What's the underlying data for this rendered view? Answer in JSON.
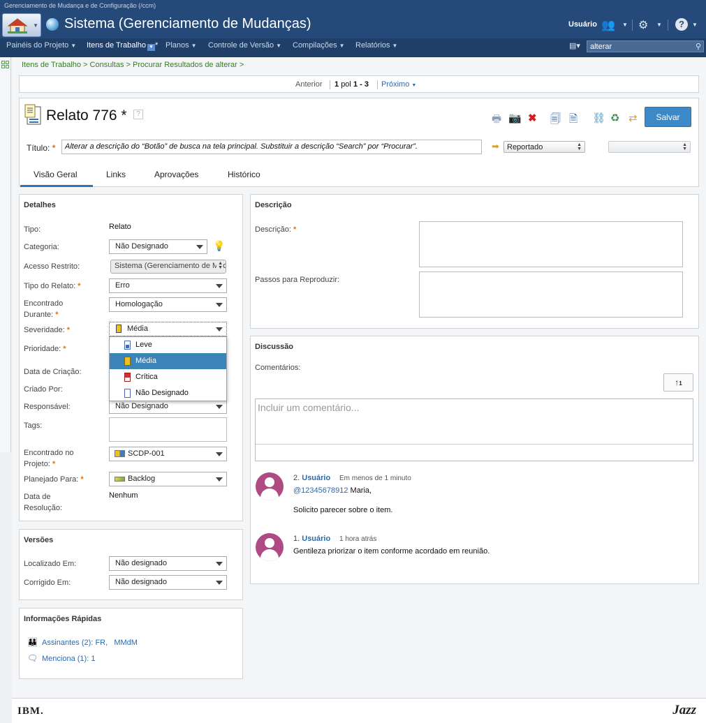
{
  "window": {
    "caption": "Gerenciamento de Mudança e de Configuração (/ccm)"
  },
  "banner": {
    "app_title": "Sistema (Gerenciamento de Mudanças)",
    "user": "Usuário"
  },
  "nav": {
    "items": [
      {
        "label": "Painéis do Projeto"
      },
      {
        "label": "Itens de Trabalho"
      },
      {
        "label": "Planos"
      },
      {
        "label": "Controle de Versão"
      },
      {
        "label": "Compilações"
      },
      {
        "label": "Relatórios"
      }
    ],
    "active_suffix": "*",
    "search_value": "alterar"
  },
  "breadcrumb": "Itens de Trabalho > Consultas > Procurar Resultados de alterar >",
  "pager": {
    "prev": "Anterior",
    "of_word": "pol",
    "current": "1",
    "range": "1 - 3",
    "next": "Próximo"
  },
  "work_item": {
    "title": "Relato 776",
    "dirty_marker": "*",
    "save_label": "Salvar",
    "title_label": "Título:",
    "summary": "Alterar a descrição do “Botão” de busca na tela principal. Substituir a descrição “Search” por “Procurar”.",
    "state": "Reportado"
  },
  "tabs": [
    {
      "label": "Visão Geral"
    },
    {
      "label": "Links"
    },
    {
      "label": "Aprovações"
    },
    {
      "label": "Histórico"
    }
  ],
  "details": {
    "section_title": "Detalhes",
    "tipo": {
      "label": "Tipo:",
      "value": "Relato"
    },
    "categoria": {
      "label": "Categoria:",
      "value": "Não Designado"
    },
    "acesso": {
      "label": "Acesso Restrito:",
      "value": "Sistema (Gerenciamento de Mudanças)"
    },
    "tipo_relato": {
      "label": "Tipo do Relato:",
      "value": "Erro"
    },
    "encontrado_durante": {
      "label1": "Encontrado",
      "label2": "Durante:",
      "value": "Homologação"
    },
    "severidade": {
      "label": "Severidade:",
      "value": "Média"
    },
    "prioridade": {
      "label": "Prioridade:"
    },
    "data_criacao": {
      "label": "Data de Criação:"
    },
    "criado_por": {
      "label": "Criado Por:"
    },
    "responsavel": {
      "label": "Responsável:",
      "value": "Não Designado"
    },
    "tags": {
      "label": "Tags:"
    },
    "encontrado_projeto": {
      "label1": "Encontrado no",
      "label2": "Projeto:",
      "value": "SCDP-001"
    },
    "planejado": {
      "label": "Planejado Para:",
      "value": "Backlog"
    },
    "data_resolucao": {
      "label1": "Data de",
      "label2": "Resolução:",
      "value": "Nenhum"
    }
  },
  "severity_options": [
    {
      "label": "Leve",
      "color": "#4a6ab0"
    },
    {
      "label": "Média",
      "color": "#f0c020"
    },
    {
      "label": "Crítica",
      "color": "#d03030"
    },
    {
      "label": "Não Designado",
      "color": "#ffffff"
    }
  ],
  "versions": {
    "section_title": "Versões",
    "localizado": {
      "label": "Localizado Em:",
      "value": "Não designado"
    },
    "corrigido": {
      "label": "Corrigido Em:",
      "value": "Não designado"
    }
  },
  "quick_info": {
    "section_title": "Informações Rápidas",
    "assinantes": "Assinantes (2):",
    "assinantes_names": [
      "FR,",
      "MMdM"
    ],
    "menciona": "Menciona (1):",
    "menciona_count": "1"
  },
  "description": {
    "section_title": "Descrição",
    "desc_label": "Descrição:",
    "steps_label": "Passos para Reproduzir:"
  },
  "discussion": {
    "section_title": "Discussão",
    "comments_label": "Comentários:",
    "placeholder": "Incluir um comentário...",
    "comments": [
      {
        "num": "2.",
        "user": "Usuário",
        "time": "Em menos de 1 minuto",
        "mention": "@12345678912",
        "line1_rest": " Maria,",
        "line2": "Solicito parecer sobre o item."
      },
      {
        "num": "1.",
        "user": "Usuário",
        "time": "1 hora atrás",
        "line1": "Gentileza priorizar o item conforme acordado em reunião."
      }
    ]
  },
  "footer": {
    "left_logo": "IBM.",
    "right_logo": "Jazz"
  }
}
